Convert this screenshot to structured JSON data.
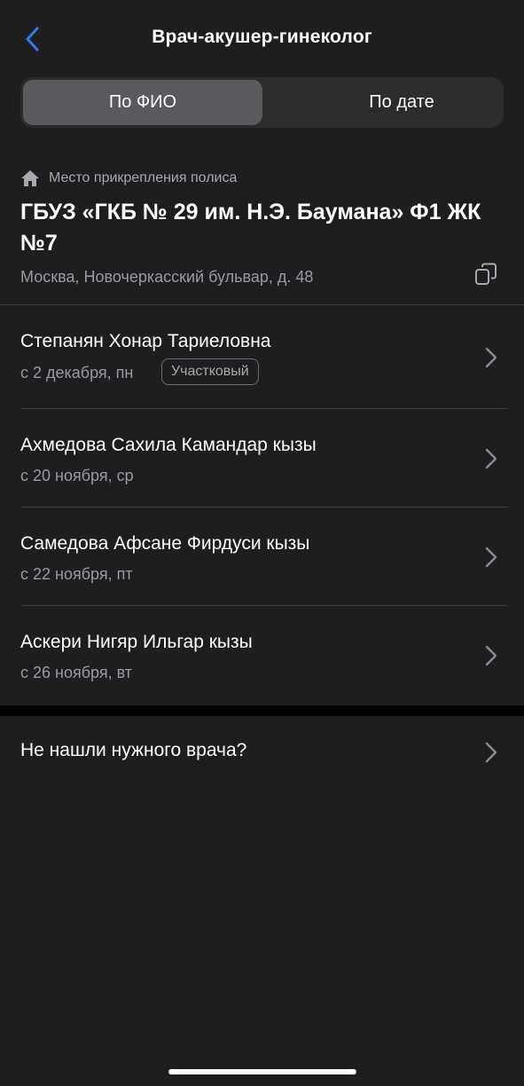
{
  "header": {
    "title": "Врач-акушер-гинеколог",
    "back_icon": "chevron-left-icon",
    "accent_color": "#2f7cf6"
  },
  "segments": {
    "by_name": "По ФИО",
    "by_date": "По дате",
    "selected": "По ФИО"
  },
  "policy": {
    "label": "Место прикрепления полиса",
    "icon": "home-icon",
    "name": "ГБУЗ «ГКБ № 29 им. Н.Э. Баумана» Ф1 ЖК №7",
    "address": "Москва, Новочеркасский бульвар, д. 48",
    "copy_icon": "copy-icon"
  },
  "doctors": [
    {
      "name": "Степанян Хонар Тариеловна",
      "date": "с 2 декабря, пн",
      "badge": "Участковый"
    },
    {
      "name": "Ахмедова Сахила Камандар кызы",
      "date": "с 20 ноября, ср"
    },
    {
      "name": "Самедова Афсане Фирдуси кызы",
      "date": "с 22 ноября, пт"
    },
    {
      "name": "Аскери Нигяр Ильгар кызы",
      "date": "с 26 ноября, вт"
    }
  ],
  "not_found": {
    "label": "Не нашли нужного врача?"
  }
}
